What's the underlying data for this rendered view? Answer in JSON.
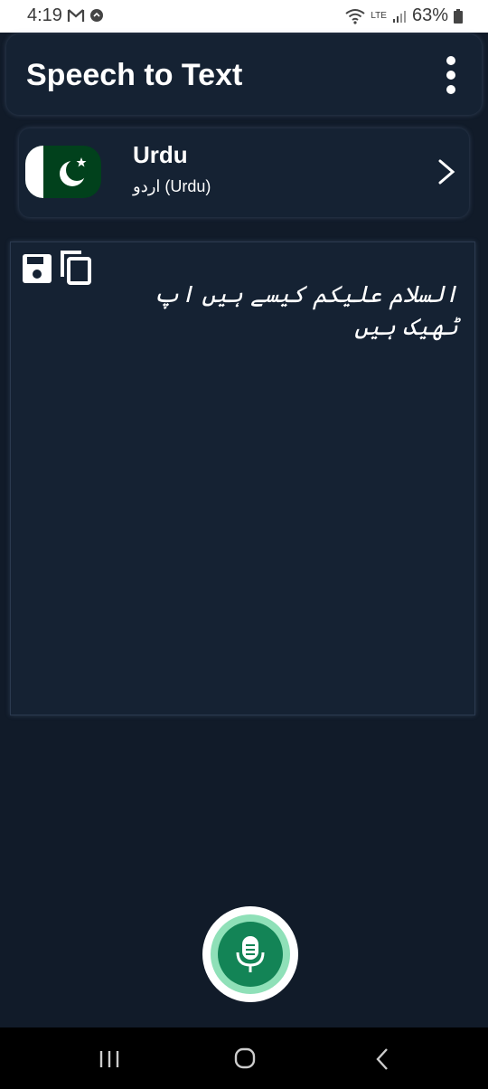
{
  "status": {
    "time": "4:19",
    "battery": "63%",
    "network": "LTE"
  },
  "app": {
    "title": "Speech to Text"
  },
  "language": {
    "name": "Urdu",
    "native": "اردو (Urdu)",
    "flag_colors": {
      "green": "#01411c",
      "white": "#ffffff"
    }
  },
  "transcript": {
    "text": "السلام علیکم کیسے ہیں اپ ٹھیک ہیں"
  },
  "colors": {
    "background": "#111b29",
    "card": "#152233",
    "mic_green": "#138456",
    "mic_ring": "#8fe0b8"
  },
  "icons": {
    "menu": "more-vertical-icon",
    "save": "floppy-disk-icon",
    "copy": "copy-icon",
    "mic": "microphone-icon",
    "chevron": "chevron-right-icon"
  }
}
